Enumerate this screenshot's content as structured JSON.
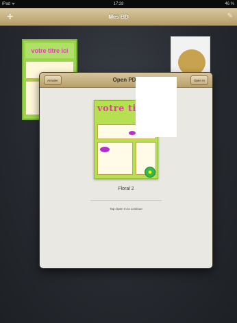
{
  "status_bar": {
    "carrier": "iPad ᯤ",
    "time": "17:28",
    "battery": "46 %"
  },
  "nav_bar": {
    "title": "Mes BD",
    "add_icon": "plus-icon",
    "edit_icon": "pencil-icon"
  },
  "modal": {
    "title": "Open PDF",
    "cancel_label": "Annuler",
    "open_label": "Open In",
    "file_name": "Floral 2",
    "hint": "Tap Open In to continue",
    "cover_logo": "votre titre"
  },
  "background": {
    "left_book_logo": "votre titre ici"
  }
}
